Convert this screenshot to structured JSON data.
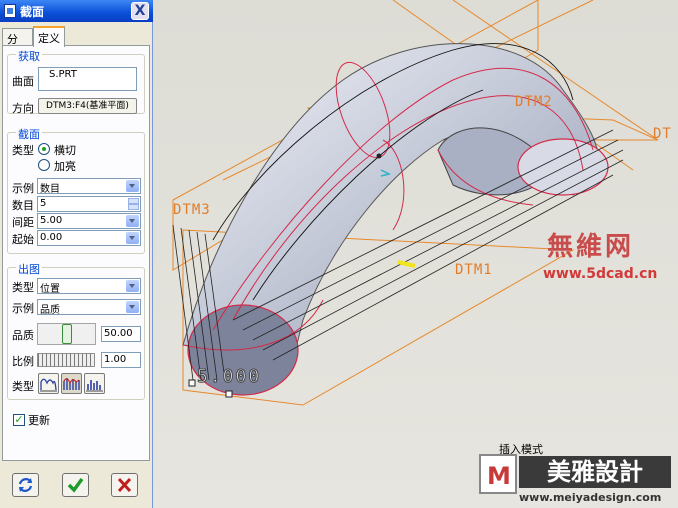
{
  "window": {
    "title": "截面",
    "close_glyph": "X"
  },
  "tabs": [
    {
      "label": "分析",
      "active": false
    },
    {
      "label": "定义",
      "active": true
    }
  ],
  "definition": {
    "group_title": "获取",
    "surface_label": "曲面",
    "surface_value": "S.PRT",
    "direction_label": "方向",
    "direction_value": "DTM3:F4(基准平面)"
  },
  "section": {
    "group_title": "截面",
    "type_label": "类型",
    "type_options": [
      {
        "label": "横切",
        "selected": true
      },
      {
        "label": "加亮",
        "selected": false
      }
    ],
    "example_label": "示例",
    "example_value": "数目",
    "count_label": "数目",
    "count_value": "5",
    "spacing_label": "间距",
    "spacing_value": "5.00",
    "start_label": "起始",
    "start_value": "0.00"
  },
  "output": {
    "group_title": "出图",
    "type_label": "类型",
    "type_value": "位置",
    "example_label": "示例",
    "example_value": "品质",
    "quality_label": "品质",
    "quality_value": "50.00",
    "quality_level": 0.5,
    "ratio_label": "比例",
    "ratio_value": "1.00",
    "chart_type_label": "类型",
    "chart_type_icons": [
      "curve-chart-icon",
      "bar-chart-icon",
      "histogram-icon"
    ],
    "update_label": "更新",
    "update_checked": true
  },
  "actions": {
    "repeat_icon": "repeat-icon",
    "ok_icon": "check-icon",
    "cancel_icon": "cancel-x-icon",
    "ok_color": "#1e9b2a",
    "cancel_color": "#c21c1c"
  },
  "viewport": {
    "datum_labels": [
      "DTM3",
      "DTM1",
      "DTM2",
      "DT"
    ],
    "dimension_text": "5.000",
    "mode_text": "插入模式",
    "watermark_cn": "無維网",
    "watermark_url": "www.5dcad.cn",
    "logo_letter": "M",
    "logo_cn": "美雅設計",
    "logo_url": "www.meiyadesign.com",
    "accent_colors": {
      "datum": "#e17e2c",
      "section": "#d42a4a",
      "surface": "#b9c2d6"
    }
  }
}
